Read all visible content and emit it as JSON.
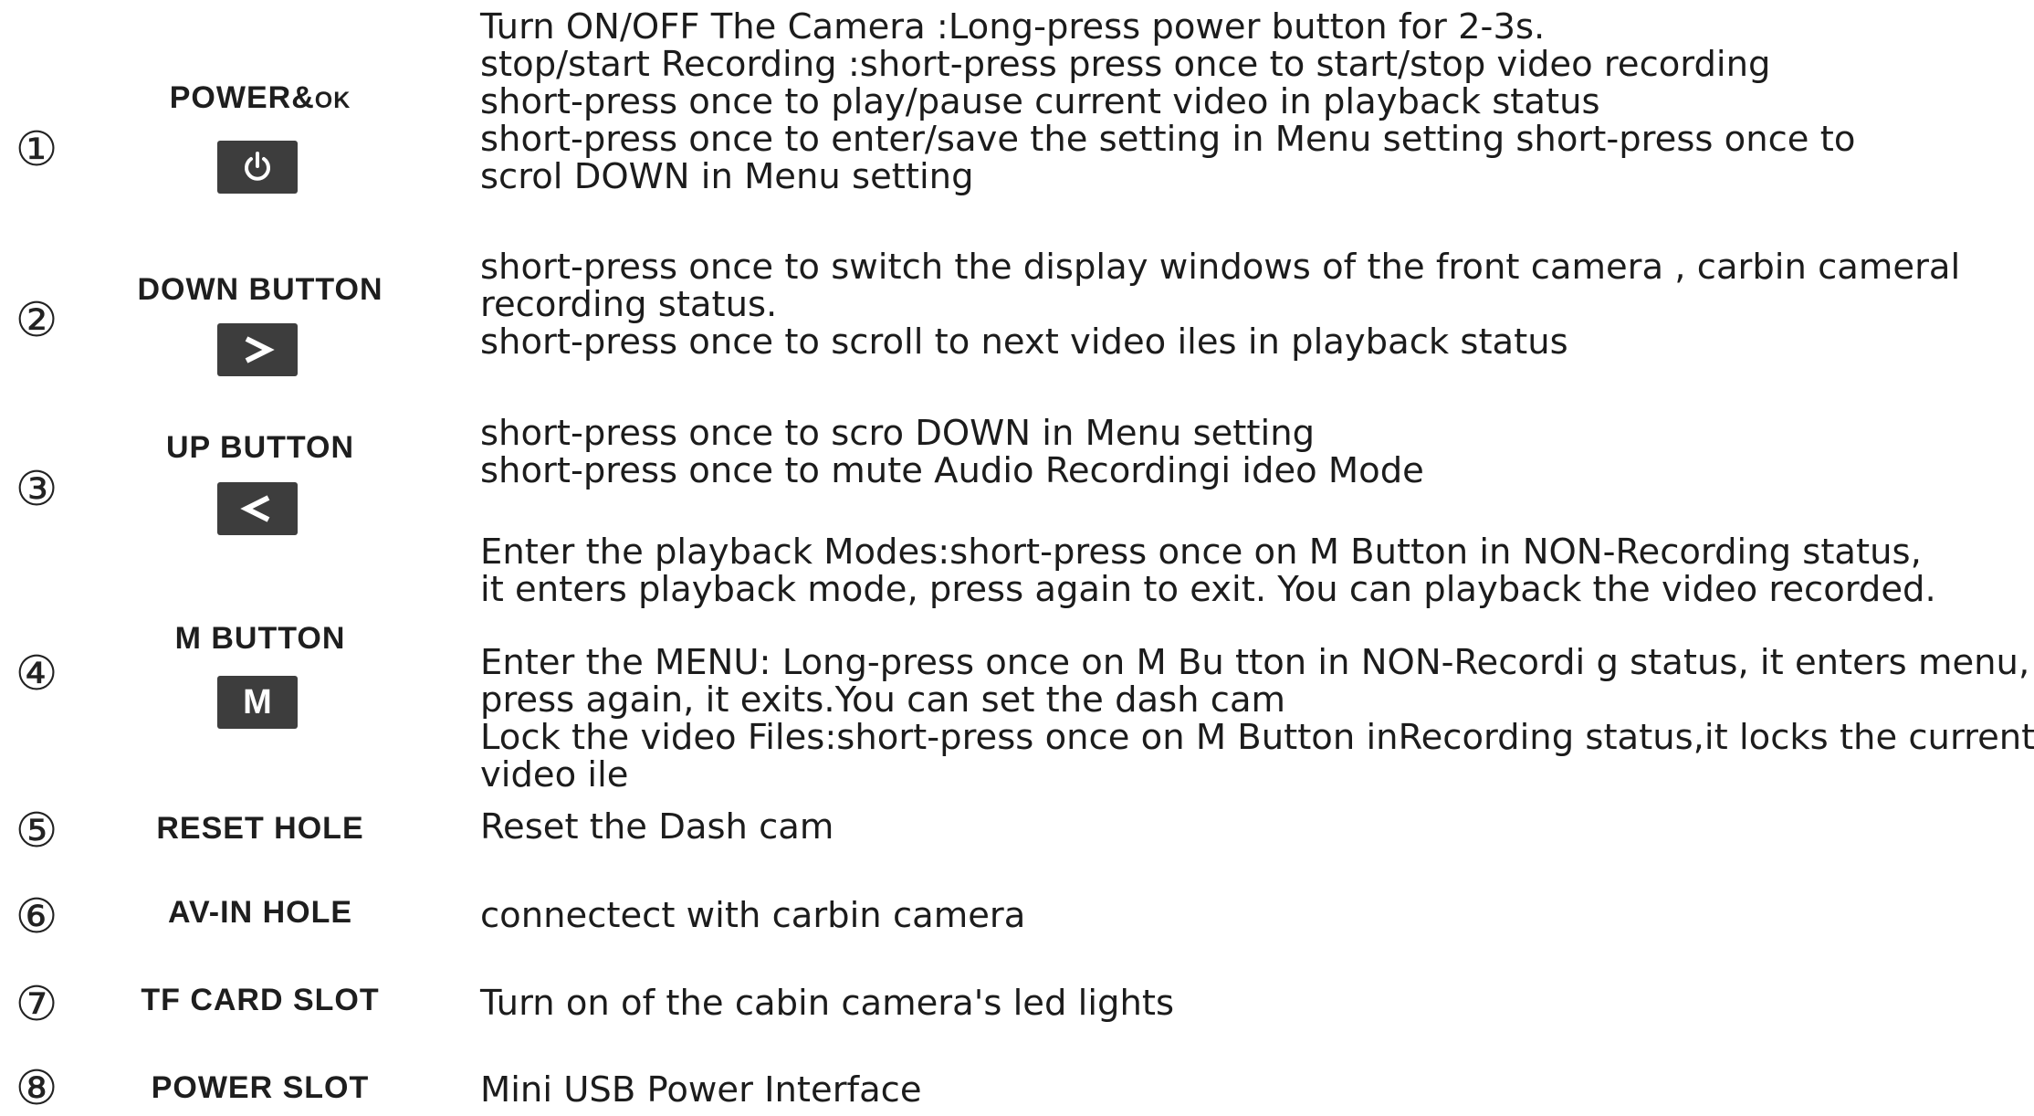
{
  "items": [
    {
      "number": "①",
      "label": "POWER&",
      "label_suffix": "OK",
      "icon": "power-icon",
      "lines": [
        "Turn ON/OFF The Camera :Long-press power button for 2-3s.",
        "stop/start Recording :short-press press once to start/stop video recording",
        "short-press once to play/pause current video in playback status",
        "short-press once to enter/save the setting in Menu setting short-press once to",
        "scrol DOWN in Menu setting"
      ]
    },
    {
      "number": "②",
      "label": "DOWN BUTTON",
      "icon": "chevron-right-icon",
      "lines": [
        "short-press once to switch the display windows of the front camera , carbin cameral",
        "recording status.",
        "short-press once to scroll to next video iles in playback status"
      ]
    },
    {
      "number": "③",
      "label": "UP BUTTON",
      "icon": "chevron-left-icon",
      "lines": [
        "short-press once to scro DOWN in Menu setting",
        "short-press once to mute Audio Recordingi ideo Mode"
      ]
    },
    {
      "number": "④",
      "label": "M  BUTTON",
      "icon_text": "M",
      "paragraphs": [
        [
          "Enter the playback Modes:short-press once on M Button in NON-Recording status,",
          "it enters playback mode, press again to exit. You can playback the video recorded."
        ],
        [
          "Enter the MENU: Long-press once on M Bu tton in NON-Recordi g status, it enters menu,",
          "press again, it exits.You can set the dash cam",
          "Lock the video Files:short-press once on M Button inRecording status,it locks the current",
          "video ile"
        ]
      ]
    },
    {
      "number": "⑤",
      "label": "RESET HOLE",
      "description": "Reset the Dash cam"
    },
    {
      "number": "⑥",
      "label": "AV-IN HOLE",
      "description": "connectect with carbin camera"
    },
    {
      "number": "⑦",
      "label": "TF CARD SLOT",
      "description": "Turn on of the cabin camera's led lights"
    },
    {
      "number": "⑧",
      "label": "POWER SLOT",
      "description": "Mini USB Power Interface"
    }
  ]
}
